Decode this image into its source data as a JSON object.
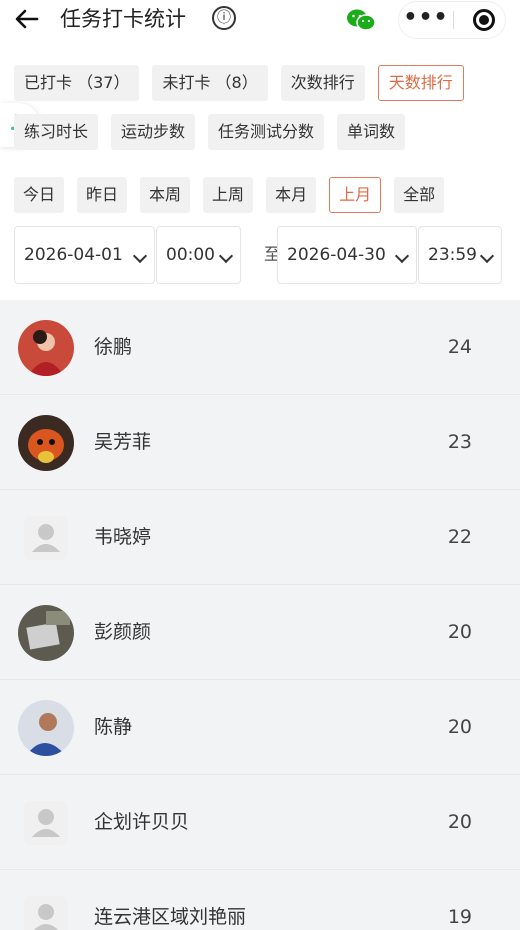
{
  "header": {
    "title": "任务打卡统计",
    "info_icon": "ⓘ",
    "more_icon": "•••"
  },
  "filters_row1": [
    {
      "label": "已打卡 （37）",
      "active": false
    },
    {
      "label": "未打卡 （8）",
      "active": false
    },
    {
      "label": "次数排行",
      "active": false
    },
    {
      "label": "天数排行",
      "active": true
    }
  ],
  "filters_row2": [
    {
      "label": "练习时长",
      "active": false
    },
    {
      "label": "运动步数",
      "active": false
    },
    {
      "label": "任务测试分数",
      "active": false
    },
    {
      "label": "单词数",
      "active": false
    }
  ],
  "periods": [
    {
      "label": "今日",
      "active": false
    },
    {
      "label": "昨日",
      "active": false
    },
    {
      "label": "本周",
      "active": false
    },
    {
      "label": "上周",
      "active": false
    },
    {
      "label": "本月",
      "active": false
    },
    {
      "label": "上月",
      "active": true
    },
    {
      "label": "全部",
      "active": false
    }
  ],
  "range": {
    "start_date": "2026-04-01",
    "start_time": "00:00",
    "separator": "至",
    "end_date": "2026-04-30",
    "end_time": "23:59"
  },
  "ranking": [
    {
      "name": "徐鹏",
      "value": "24",
      "avatar": "photo-red"
    },
    {
      "name": "吴芳菲",
      "value": "23",
      "avatar": "photo-fox"
    },
    {
      "name": "韦晓婷",
      "value": "22",
      "avatar": "default"
    },
    {
      "name": "彭颜颜",
      "value": "20",
      "avatar": "photo-grey"
    },
    {
      "name": "陈静",
      "value": "20",
      "avatar": "photo-blue"
    },
    {
      "name": "企划许贝贝",
      "value": "20",
      "avatar": "default"
    },
    {
      "name": "连云港区域刘艳丽",
      "value": "19",
      "avatar": "default"
    }
  ],
  "colors": {
    "accent": "#e06a45",
    "list_bg": "#f2f3f5",
    "chip_bg": "#f1f1f1",
    "wechat_green": "#1aad19"
  }
}
